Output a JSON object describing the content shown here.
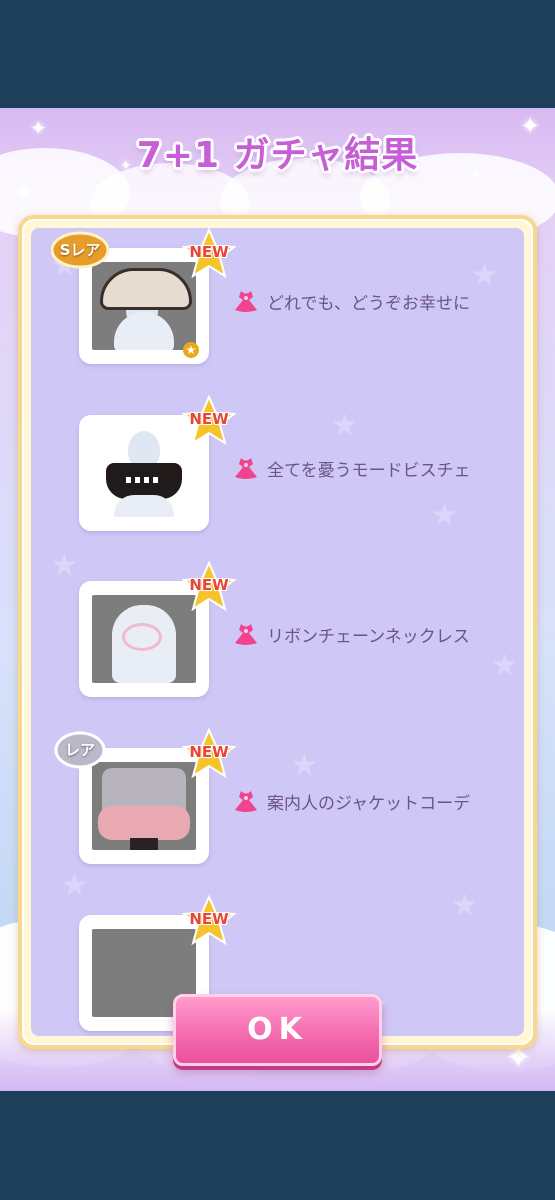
{
  "screen": {
    "title": "7+1 ガチャ結果",
    "ok_label": "OK"
  },
  "items": [
    {
      "name": "どれでも、どうぞお幸せに",
      "new_label": "NEW",
      "rarity": "Sレア",
      "rarity_color": "#e79d2a",
      "icon": "dress-icon"
    },
    {
      "name": "全てを憂うモードビスチェ",
      "new_label": "NEW",
      "rarity": "",
      "icon": "dress-icon"
    },
    {
      "name": "リボンチェーンネックレス",
      "new_label": "NEW",
      "rarity": "",
      "icon": "dress-icon"
    },
    {
      "name": "案内人のジャケットコーデ",
      "new_label": "NEW",
      "rarity": "レア",
      "rarity_color": "#b9b9c9",
      "icon": "dress-icon"
    },
    {
      "name": "",
      "new_label": "NEW",
      "rarity": "",
      "icon": "dress-icon"
    }
  ],
  "colors": {
    "accent_pink": "#f56eb0",
    "title": "#c65fd6",
    "panel_border": "#f7d88f",
    "panel_bg": "#cfc8f6",
    "new_badge": "#f6c42a"
  }
}
